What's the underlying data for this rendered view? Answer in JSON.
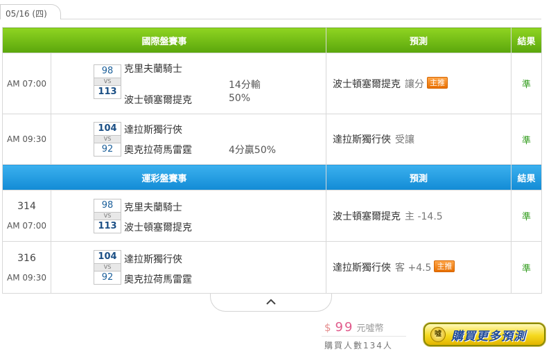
{
  "date_tab": "05/16 (四)",
  "international": {
    "header": {
      "event": "國際盤賽事",
      "predict": "預測",
      "result": "結果"
    },
    "rows": [
      {
        "time": "AM 07:00",
        "score1": "98",
        "score2": "113",
        "vs": "VS",
        "team1": "克里夫蘭騎士",
        "team2": "波士頓塞爾提克",
        "odds1": "14分輸",
        "odds2": "50%",
        "pick": "波士頓塞爾提克",
        "pick_sub": "讓分",
        "badge": "主推",
        "result": "準"
      },
      {
        "time": "AM 09:30",
        "score1": "104",
        "score2": "92",
        "vs": "VS",
        "team1": "達拉斯獨行俠",
        "team2": "奧克拉荷馬雷霆",
        "odds2": "4分贏50%",
        "pick": "達拉斯獨行俠",
        "pick_sub": "受讓",
        "result": "準"
      }
    ]
  },
  "lottery": {
    "header": {
      "event": "運彩盤賽事",
      "predict": "預測",
      "result": "結果"
    },
    "rows": [
      {
        "number": "314",
        "time": "AM 07:00",
        "score1": "98",
        "score2": "113",
        "vs": "VS",
        "team1": "克里夫蘭騎士",
        "team2": "波士頓塞爾提克",
        "pick": "波士頓塞爾提克",
        "pick_sub": "主 -14.5",
        "result": "準"
      },
      {
        "number": "316",
        "time": "AM 09:30",
        "score1": "104",
        "score2": "92",
        "vs": "VS",
        "team1": "達拉斯獨行俠",
        "team2": "奧克拉荷馬雷霆",
        "pick": "達拉斯獨行俠",
        "pick_sub": "客 +4.5",
        "badge": "主推",
        "result": "準"
      }
    ]
  },
  "purchase": {
    "currency_symbol": "$",
    "price": "99",
    "currency": "元噓幣",
    "buyers": "購買人數134人",
    "button_label": "購買更多預測",
    "button_icon": "coin-icon"
  }
}
